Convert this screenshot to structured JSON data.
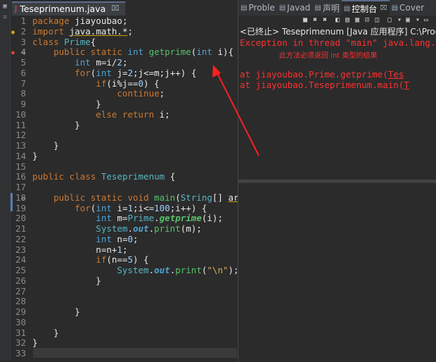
{
  "editor": {
    "tab_title": "Teseprimenum.java",
    "tab_close": "⌧",
    "lines": [
      {
        "n": "1",
        "segments": [
          {
            "t": "package ",
            "c": "k"
          },
          {
            "t": "jiayoubao;",
            "c": "pkg"
          }
        ]
      },
      {
        "n": "2",
        "segments": [
          {
            "t": "import ",
            "c": "k"
          },
          {
            "t": "java.math.*",
            "c": "pkg und"
          },
          {
            "t": ";",
            "c": "pkg"
          }
        ]
      },
      {
        "n": "3",
        "segments": [
          {
            "t": "class ",
            "c": "k"
          },
          {
            "t": "Prime",
            "c": "cls"
          },
          {
            "t": "{",
            "c": "pkg"
          }
        ]
      },
      {
        "n": "4",
        "segments": [
          {
            "t": "    public static ",
            "c": "k"
          },
          {
            "t": "int ",
            "c": "ty"
          },
          {
            "t": "getprime",
            "c": "fn"
          },
          {
            "t": "(",
            "c": "pkg"
          },
          {
            "t": "int ",
            "c": "ty"
          },
          {
            "t": "i",
            "c": "pkg"
          },
          {
            "t": "){",
            "c": "pkg"
          }
        ]
      },
      {
        "n": "5",
        "segments": [
          {
            "t": "        int ",
            "c": "ty"
          },
          {
            "t": "m=i/",
            "c": "pkg"
          },
          {
            "t": "2",
            "c": "num"
          },
          {
            "t": ";",
            "c": "pkg"
          }
        ]
      },
      {
        "n": "6",
        "segments": [
          {
            "t": "        for",
            "c": "k"
          },
          {
            "t": "(",
            "c": "pkg"
          },
          {
            "t": "int ",
            "c": "ty"
          },
          {
            "t": "j=",
            "c": "pkg"
          },
          {
            "t": "2",
            "c": "num"
          },
          {
            "t": ";j<=m;j++) {",
            "c": "pkg"
          }
        ]
      },
      {
        "n": "7",
        "segments": [
          {
            "t": "            if",
            "c": "k"
          },
          {
            "t": "(i%j==",
            "c": "pkg"
          },
          {
            "t": "0",
            "c": "num"
          },
          {
            "t": ") {",
            "c": "pkg"
          }
        ]
      },
      {
        "n": "8",
        "segments": [
          {
            "t": "                continue",
            "c": "k"
          },
          {
            "t": ";",
            "c": "pkg"
          }
        ]
      },
      {
        "n": "9",
        "segments": [
          {
            "t": "            }",
            "c": "pkg"
          }
        ]
      },
      {
        "n": "10",
        "segments": [
          {
            "t": "            else return ",
            "c": "k"
          },
          {
            "t": "i;",
            "c": "pkg"
          }
        ]
      },
      {
        "n": "11",
        "segments": [
          {
            "t": "        }",
            "c": "pkg"
          }
        ]
      },
      {
        "n": "12",
        "segments": []
      },
      {
        "n": "13",
        "segments": [
          {
            "t": "    }",
            "c": "pkg"
          }
        ]
      },
      {
        "n": "14",
        "segments": [
          {
            "t": "}",
            "c": "pkg"
          }
        ]
      },
      {
        "n": "15",
        "segments": []
      },
      {
        "n": "16",
        "segments": [
          {
            "t": "public class ",
            "c": "k"
          },
          {
            "t": "Teseprimenum ",
            "c": "cls"
          },
          {
            "t": "{",
            "c": "pkg"
          }
        ]
      },
      {
        "n": "17",
        "segments": []
      },
      {
        "n": "18",
        "segments": [
          {
            "t": "    public static void ",
            "c": "k"
          },
          {
            "t": "main",
            "c": "fn"
          },
          {
            "t": "(",
            "c": "pkg"
          },
          {
            "t": "String",
            "c": "cls"
          },
          {
            "t": "[] ",
            "c": "pkg"
          },
          {
            "t": "args",
            "c": "pkg und"
          },
          {
            "t": ") {",
            "c": "pkg"
          }
        ]
      },
      {
        "n": "19",
        "segments": [
          {
            "t": "        for",
            "c": "k"
          },
          {
            "t": "(",
            "c": "pkg"
          },
          {
            "t": "int ",
            "c": "ty"
          },
          {
            "t": "i=",
            "c": "pkg"
          },
          {
            "t": "1",
            "c": "num"
          },
          {
            "t": ";i<=",
            "c": "pkg"
          },
          {
            "t": "100",
            "c": "num"
          },
          {
            "t": ";i++) {",
            "c": "pkg"
          }
        ]
      },
      {
        "n": "20",
        "segments": [
          {
            "t": "            int ",
            "c": "ty"
          },
          {
            "t": "m=",
            "c": "pkg"
          },
          {
            "t": "Prime",
            "c": "cls"
          },
          {
            "t": ".",
            "c": "pkg"
          },
          {
            "t": "getprime",
            "c": "fn it"
          },
          {
            "t": "(i);",
            "c": "pkg"
          }
        ]
      },
      {
        "n": "21",
        "segments": [
          {
            "t": "            System",
            "c": "cls"
          },
          {
            "t": ".",
            "c": "pkg"
          },
          {
            "t": "out",
            "c": "ty it"
          },
          {
            "t": ".",
            "c": "pkg"
          },
          {
            "t": "print",
            "c": "fn"
          },
          {
            "t": "(m);",
            "c": "pkg"
          }
        ]
      },
      {
        "n": "22",
        "segments": [
          {
            "t": "            int ",
            "c": "ty"
          },
          {
            "t": "n=",
            "c": "pkg"
          },
          {
            "t": "0",
            "c": "num"
          },
          {
            "t": ";",
            "c": "pkg"
          }
        ]
      },
      {
        "n": "23",
        "segments": [
          {
            "t": "            n=n+",
            "c": "pkg"
          },
          {
            "t": "1",
            "c": "num"
          },
          {
            "t": ";",
            "c": "pkg"
          }
        ]
      },
      {
        "n": "24",
        "segments": [
          {
            "t": "            if",
            "c": "k"
          },
          {
            "t": "(n==",
            "c": "pkg"
          },
          {
            "t": "5",
            "c": "num"
          },
          {
            "t": ") {",
            "c": "pkg"
          }
        ]
      },
      {
        "n": "25",
        "segments": [
          {
            "t": "                System",
            "c": "cls"
          },
          {
            "t": ".",
            "c": "pkg"
          },
          {
            "t": "out",
            "c": "ty it"
          },
          {
            "t": ".",
            "c": "pkg"
          },
          {
            "t": "print",
            "c": "fn"
          },
          {
            "t": "(",
            "c": "pkg"
          },
          {
            "t": "\"\\n\"",
            "c": "str"
          },
          {
            "t": ");",
            "c": "pkg"
          }
        ]
      },
      {
        "n": "26",
        "segments": [
          {
            "t": "            }",
            "c": "pkg"
          }
        ]
      },
      {
        "n": "27",
        "segments": []
      },
      {
        "n": "28",
        "segments": []
      },
      {
        "n": "29",
        "segments": [
          {
            "t": "        }",
            "c": "pkg"
          }
        ]
      },
      {
        "n": "30",
        "segments": []
      },
      {
        "n": "31",
        "segments": [
          {
            "t": "    }",
            "c": "pkg"
          }
        ]
      },
      {
        "n": "32",
        "segments": [
          {
            "t": "}",
            "c": "pkg"
          }
        ]
      },
      {
        "n": "33",
        "segments": []
      }
    ]
  },
  "console": {
    "tabs": [
      {
        "label": "Proble",
        "icon": "problems-icon"
      },
      {
        "label": "Javad",
        "icon": "javadoc-icon"
      },
      {
        "label": "声明",
        "icon": "declaration-icon"
      },
      {
        "label": "控制台",
        "icon": "console-icon",
        "active": true
      },
      {
        "label": "Cover",
        "icon": "coverage-icon"
      }
    ],
    "tab_close": "⌧",
    "header": "<已终止> Teseprimenum [Java 应用程序] C:\\Program",
    "error_line": "Exception in thread \"main\" java.lang.Err",
    "annotation": "此方法必须返回 int 类型的结果",
    "trace": [
      {
        "prefix": "        at jiayoubao.Prime.getprime(",
        "link": "Tes"
      },
      {
        "prefix": "        at jiayoubao.Teseprimenum.main(",
        "link": "T"
      }
    ]
  },
  "colors": {
    "error": "#ff3030",
    "arrow": "#ff2020",
    "background": "#2b2b2b"
  }
}
